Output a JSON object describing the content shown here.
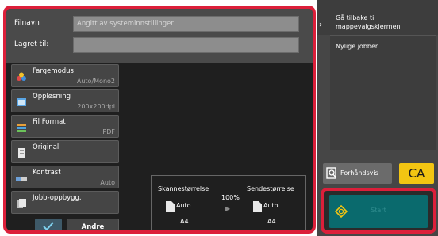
{
  "fields": {
    "filename_label": "Filnavn",
    "filename_placeholder": "Angitt av systeminnstillinger",
    "savedto_label": "Lagret til:"
  },
  "settings": [
    {
      "label": "Fargemodus",
      "value": "Auto/Mono2",
      "icon": "color-mode-icon"
    },
    {
      "label": "Oppløsning",
      "value": "200x200dpi",
      "icon": "resolution-icon"
    },
    {
      "label": "Fil Format",
      "value": "PDF",
      "icon": "file-format-icon"
    },
    {
      "label": "Original",
      "value": "",
      "icon": "original-icon"
    },
    {
      "label": "Kontrast",
      "value": "Auto",
      "icon": "contrast-icon"
    },
    {
      "label": "Jobb-oppbygg.",
      "value": "",
      "icon": "job-build-icon"
    }
  ],
  "bottom": {
    "other_label": "Andre"
  },
  "scan_size": {
    "scan_label": "Skannestørrelse",
    "send_label": "Sendestørrelse",
    "scan_auto": "Auto",
    "send_auto": "Auto",
    "scan_paper": "A4",
    "send_paper": "A4",
    "ratio": "100%"
  },
  "right": {
    "back_label_line1": "Gå tilbake til",
    "back_label_line2": "mappevalgskjermen",
    "recent_jobs": "Nylige jobber",
    "preview_label": "Forhåndsvis",
    "ca_label": "CA",
    "start_label": "Start"
  },
  "colors": {
    "accent": "#dc1f3a",
    "start": "#0a6a6d",
    "ca": "#f3c512"
  }
}
